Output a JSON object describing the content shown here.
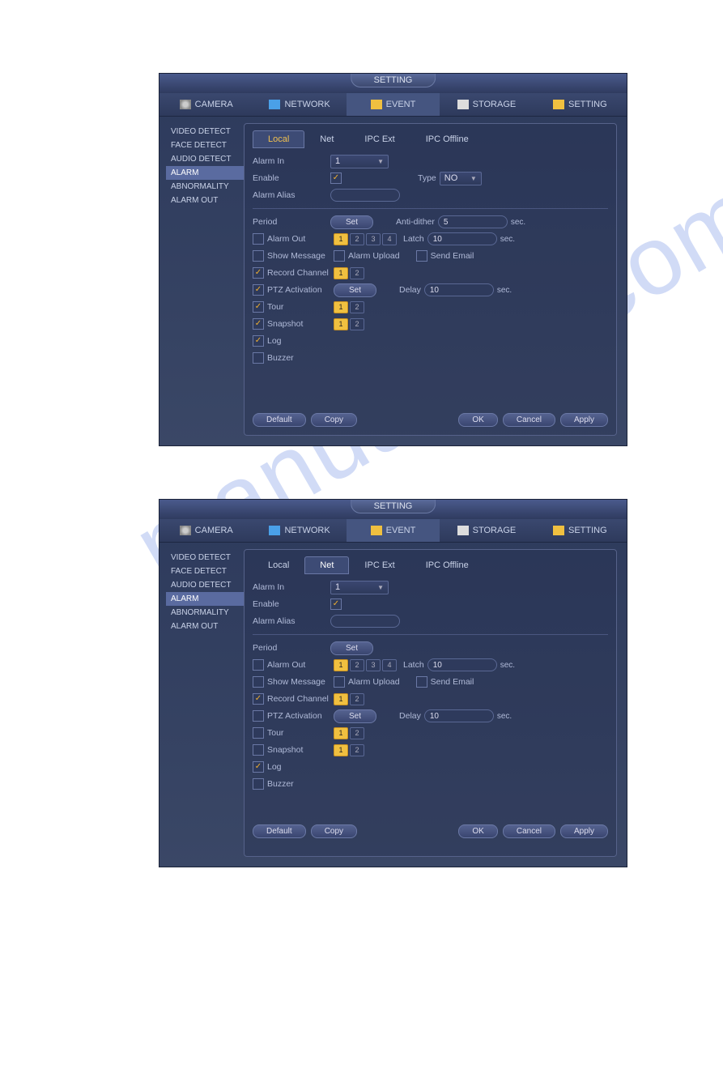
{
  "w1": {
    "title": "SETTING",
    "alarmin": "1",
    "type": "NO",
    "antidither": "5",
    "latch": "10",
    "delay": "10"
  },
  "w2": {
    "title": "SETTING",
    "alarmin": "1",
    "latch": "10",
    "delay": "10"
  },
  "tabs": {
    "camera": "CAMERA",
    "network": "NETWORK",
    "event": "EVENT",
    "storage": "STORAGE",
    "setting": "SETTING"
  },
  "side": {
    "video": "VIDEO DETECT",
    "face": "FACE DETECT",
    "audio": "AUDIO DETECT",
    "alarm": "ALARM",
    "abnorm": "ABNORMALITY",
    "alarmout": "ALARM OUT"
  },
  "sub": {
    "local": "Local",
    "net": "Net",
    "ipcext": "IPC Ext",
    "ipcoff": "IPC Offline"
  },
  "f": {
    "alarmin": "Alarm In",
    "enable": "Enable",
    "type": "Type",
    "alias": "Alarm Alias",
    "period": "Period",
    "set": "Set",
    "antidither": "Anti-dither",
    "sec": "sec.",
    "alarmout": "Alarm Out",
    "latch": "Latch",
    "showmsg": "Show Message",
    "upload": "Alarm Upload",
    "email": "Send Email",
    "recchan": "Record Channel",
    "ptz": "PTZ Activation",
    "delay": "Delay",
    "tour": "Tour",
    "snapshot": "Snapshot",
    "log": "Log",
    "buzzer": "Buzzer"
  },
  "btn": {
    "default": "Default",
    "copy": "Copy",
    "ok": "OK",
    "cancel": "Cancel",
    "apply": "Apply"
  }
}
